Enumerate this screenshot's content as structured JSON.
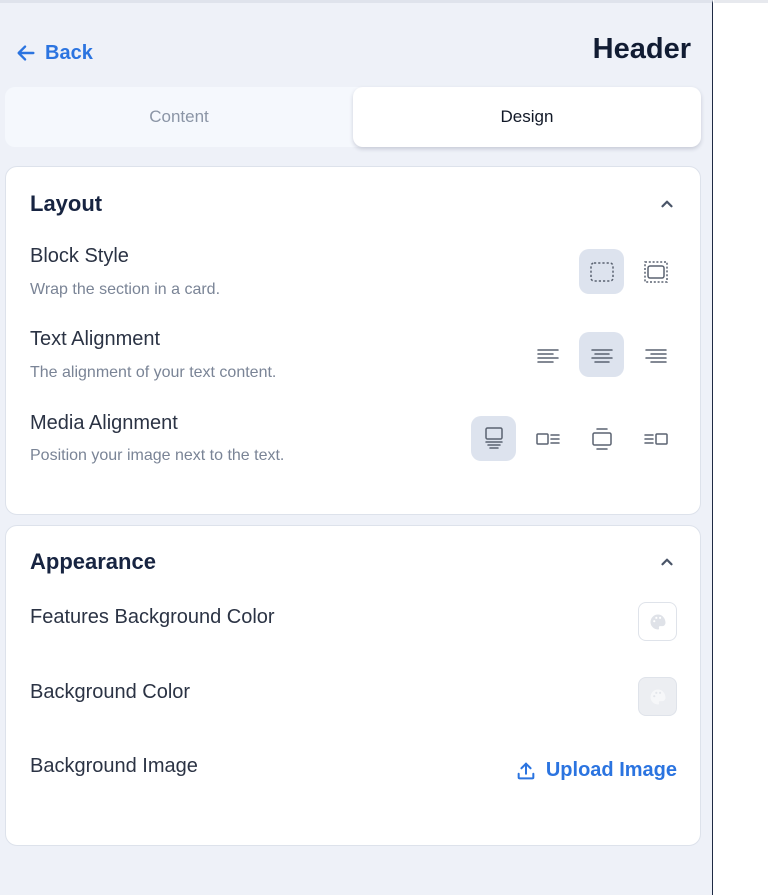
{
  "header": {
    "back_label": "Back",
    "title": "Header"
  },
  "tabs": [
    {
      "label": "Content",
      "active": false
    },
    {
      "label": "Design",
      "active": true
    }
  ],
  "layout": {
    "title": "Layout",
    "rows": [
      {
        "label": "Block Style",
        "desc": "Wrap the section in a card.",
        "options": [
          "no-card-icon",
          "card-icon"
        ],
        "selected": 0
      },
      {
        "label": "Text Alignment",
        "desc": "The alignment of your text content.",
        "options": [
          "align-left-icon",
          "align-center-icon",
          "align-right-icon"
        ],
        "selected": 1
      },
      {
        "label": "Media Alignment",
        "desc": "Position your image next to the text.",
        "options": [
          "media-top-icon",
          "media-left-icon",
          "media-center-icon",
          "media-right-icon"
        ],
        "selected": 0
      }
    ]
  },
  "appearance": {
    "title": "Appearance",
    "features_bg_label": "Features Background Color",
    "bg_color_label": "Background Color",
    "bg_image_label": "Background Image",
    "upload_label": "Upload Image"
  },
  "colors": {
    "accent": "#2b74e0",
    "panel_bg": "#eef1f8",
    "selected_option_bg": "#dde3ee",
    "title_text": "#172441"
  }
}
